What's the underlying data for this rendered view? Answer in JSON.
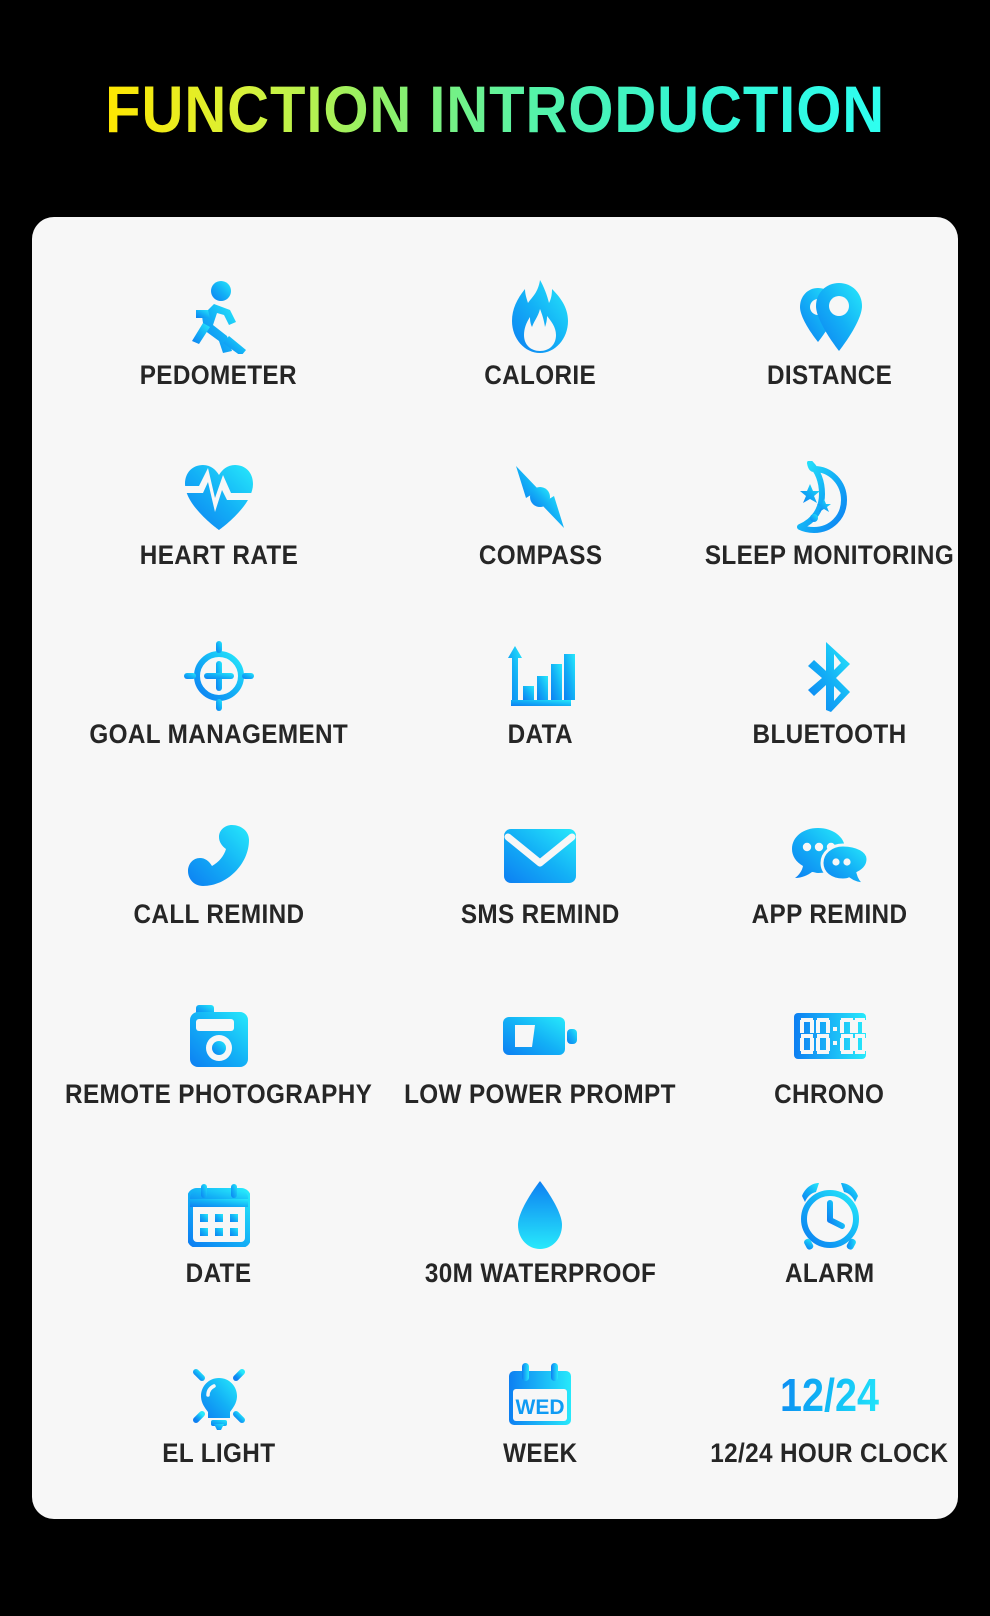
{
  "page": {
    "background_color": "#000000",
    "card_color": "#f7f7f7",
    "title": "FUNCTION INTRODUCTION",
    "title_gradient_start": "#ffe600",
    "title_gradient_end": "#2ffff0",
    "icon_gradient_start": "#0d8bf2",
    "icon_gradient_end": "#23e5fb",
    "label_color": "#262626"
  },
  "features": [
    {
      "icon": "running-person-icon",
      "label": "PEDOMETER"
    },
    {
      "icon": "flame-icon",
      "label": "CALORIE"
    },
    {
      "icon": "map-pins-icon",
      "label": "DISTANCE"
    },
    {
      "icon": "heart-pulse-icon",
      "label": "HEART RATE"
    },
    {
      "icon": "compass-needle-icon",
      "label": "COMPASS"
    },
    {
      "icon": "moon-stars-icon",
      "label": "SLEEP MONITORING"
    },
    {
      "icon": "target-crosshair-icon",
      "label": "GOAL MANAGEMENT"
    },
    {
      "icon": "bar-chart-icon",
      "label": "DATA"
    },
    {
      "icon": "bluetooth-icon",
      "label": "BLUETOOTH"
    },
    {
      "icon": "phone-handset-icon",
      "label": "CALL REMIND"
    },
    {
      "icon": "envelope-icon",
      "label": "SMS REMIND"
    },
    {
      "icon": "chat-bubbles-icon",
      "label": "APP REMIND"
    },
    {
      "icon": "camera-icon",
      "label": "REMOTE PHOTOGRAPHY"
    },
    {
      "icon": "battery-low-icon",
      "label": "LOW POWER PROMPT"
    },
    {
      "icon": "digital-clock-icon",
      "label": "CHRONO"
    },
    {
      "icon": "calendar-grid-icon",
      "label": "DATE"
    },
    {
      "icon": "water-drop-icon",
      "label": "30M WATERPROOF"
    },
    {
      "icon": "alarm-clock-icon",
      "label": "ALARM"
    },
    {
      "icon": "light-bulb-icon",
      "label": "EL LIGHT"
    },
    {
      "icon": "calendar-week-icon",
      "label": "WEEK"
    },
    {
      "icon": "twelve-twentyfour-icon",
      "label": "12/24 HOUR CLOCK"
    }
  ],
  "icon_text": {
    "digital_clock": "00:00",
    "calendar_week": "WED",
    "twelve_twentyfour": "12/24"
  }
}
